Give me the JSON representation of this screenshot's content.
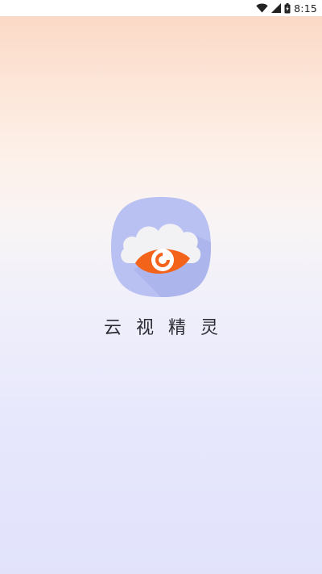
{
  "status_bar": {
    "time": "8:15",
    "icons": [
      "wifi-icon",
      "signal-icon",
      "battery-icon"
    ]
  },
  "splash": {
    "app_name": "云视精灵",
    "logo": "cloud-eye-logo"
  },
  "colors": {
    "logo_bg": "#b9c1f3",
    "cloud": "#f2f2f4",
    "eye_orange": "#f4631a",
    "text": "#2b2b33"
  }
}
